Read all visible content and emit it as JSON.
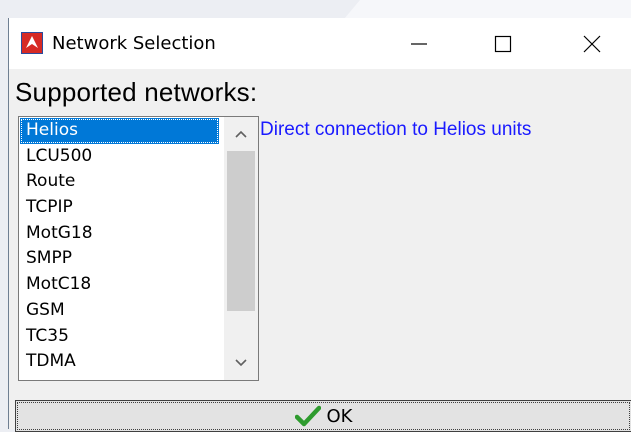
{
  "window": {
    "title": "Network Selection",
    "icon": "app-logo-icon",
    "controls": {
      "minimize_icon": "minimize-icon",
      "maximize_icon": "maximize-icon",
      "close_icon": "close-icon"
    }
  },
  "networks": {
    "label": "Supported networks:",
    "selected": "Helios",
    "items": [
      "Helios",
      "LCU500",
      "Route",
      "TCPIP",
      "MotG18",
      "SMPP",
      "MotC18",
      "GSM",
      "TC35",
      "TDMA"
    ],
    "description": "Direct connection to Helios units"
  },
  "ok_button": {
    "label": "OK",
    "icon": "checkmark-icon"
  },
  "colors": {
    "selection": "#0078d7",
    "description_text": "#1a1aff",
    "checkmark": "#2e9b2e"
  }
}
